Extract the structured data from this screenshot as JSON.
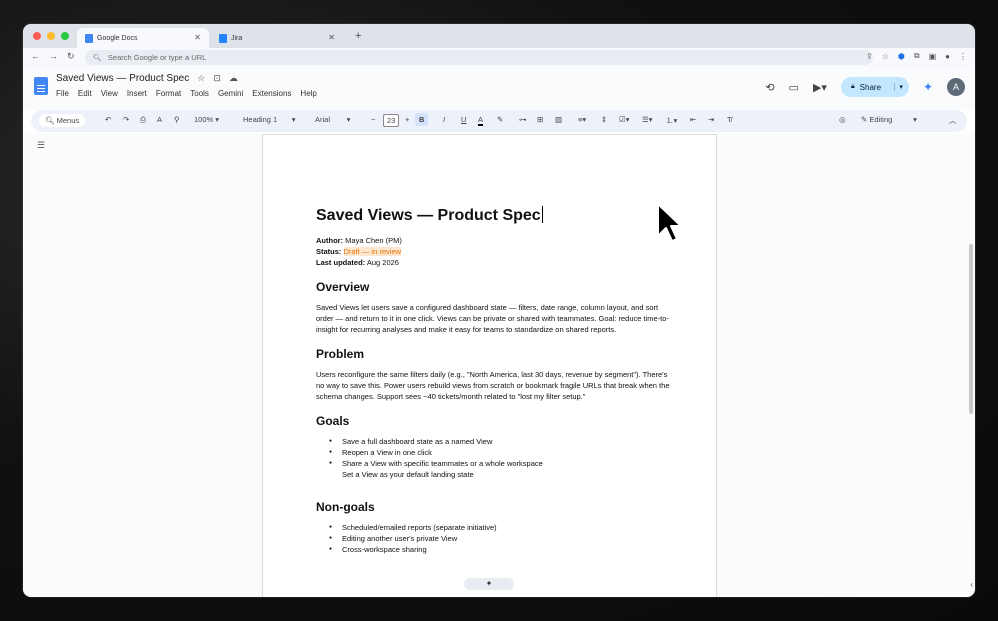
{
  "browser": {
    "tabs": [
      {
        "label": "Google Docs",
        "active": true,
        "favicon_color": "#4285f4"
      },
      {
        "label": "Jira",
        "active": false,
        "favicon_color": "#2684ff"
      }
    ],
    "new_tab_icon": "+",
    "omnibox_placeholder": "Search Google or type a URL"
  },
  "docs": {
    "title": "Saved Views — Product Spec",
    "menu": [
      "File",
      "Edit",
      "View",
      "Insert",
      "Format",
      "Tools",
      "Gemini",
      "Extensions",
      "Help"
    ],
    "share_label": "Share",
    "avatar_initial": "A"
  },
  "toolbar": {
    "menus_label": "Menus",
    "zoom": "100%",
    "style": "Heading 1",
    "font": "Arial",
    "font_size": "23",
    "mode": "Editing"
  },
  "document": {
    "title": "Saved Views — Product Spec",
    "meta": {
      "author_label": "Author:",
      "author_value": " Maya Chen (PM)",
      "status_label": "Status:",
      "status_value": "Draft — in review",
      "updated_label": "Last updated:",
      "updated_value": " Aug 2026"
    },
    "overview_heading": "Overview",
    "overview_text": "Saved Views let users save a configured dashboard state — filters, date range, column layout, and sort order — and return to it in one click. Views can be private or shared with teammates. Goal: reduce time-to-insight for recurring analyses and make it easy for teams to standardize on shared reports.",
    "problem_heading": "Problem",
    "problem_text": "Users reconfigure the same filters daily (e.g., \"North America, last 30 days, revenue by segment\"). There's no way to save this. Power users rebuild views from scratch or bookmark fragile URLs that break when the schema changes. Support sees ~40 tickets/month related to \"lost my filter setup.\"",
    "goals_heading": "Goals",
    "goals": [
      "Save a full dashboard state as a named View",
      "Reopen a View in one click",
      "Share a View with specific teammates or a whole workspace",
      "Set a View as your default landing state"
    ],
    "nongoals_heading": "Non-goals",
    "nongoals": [
      "Scheduled/emailed reports (separate initiative)",
      "Editing another user's private View",
      "Cross-workspace sharing"
    ]
  },
  "colors": {
    "accent": "#1a73e8",
    "share_bg": "#c2e7ff",
    "status_highlight": "#e8710a"
  }
}
